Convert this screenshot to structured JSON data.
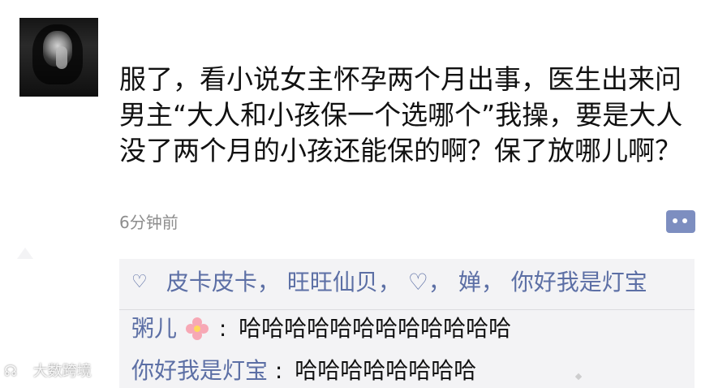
{
  "post": {
    "text": "服了，看小说女主怀孕两个月出事，医生出来问男主“大人和小孩保一个选哪个”我操，要是大人没了两个月的小孩还能保的啊？保了放哪儿啊？",
    "time": "6分钟前"
  },
  "likes": {
    "icon": "heart-outline-icon",
    "names": [
      "皮卡皮卡",
      "旺旺仙贝",
      "♡",
      "婵",
      "你好我是灯宝"
    ],
    "separator": "，"
  },
  "comments": [
    {
      "author": "粥儿",
      "emoji": "pink-flower-icon",
      "colon": ":",
      "text": "哈哈哈哈哈哈哈哈哈哈哈哈"
    },
    {
      "author": "你好我是灯宝",
      "colon": ":",
      "text": "哈哈哈哈哈哈哈哈"
    }
  ],
  "watermark": {
    "icon_text": "☊",
    "text": "大数跨境"
  },
  "colors": {
    "link_blue": "#5c6fa5",
    "panel_bg": "#f3f3f5",
    "time_gray": "#8d8d8d",
    "comment_button": "#7d8ec0"
  }
}
